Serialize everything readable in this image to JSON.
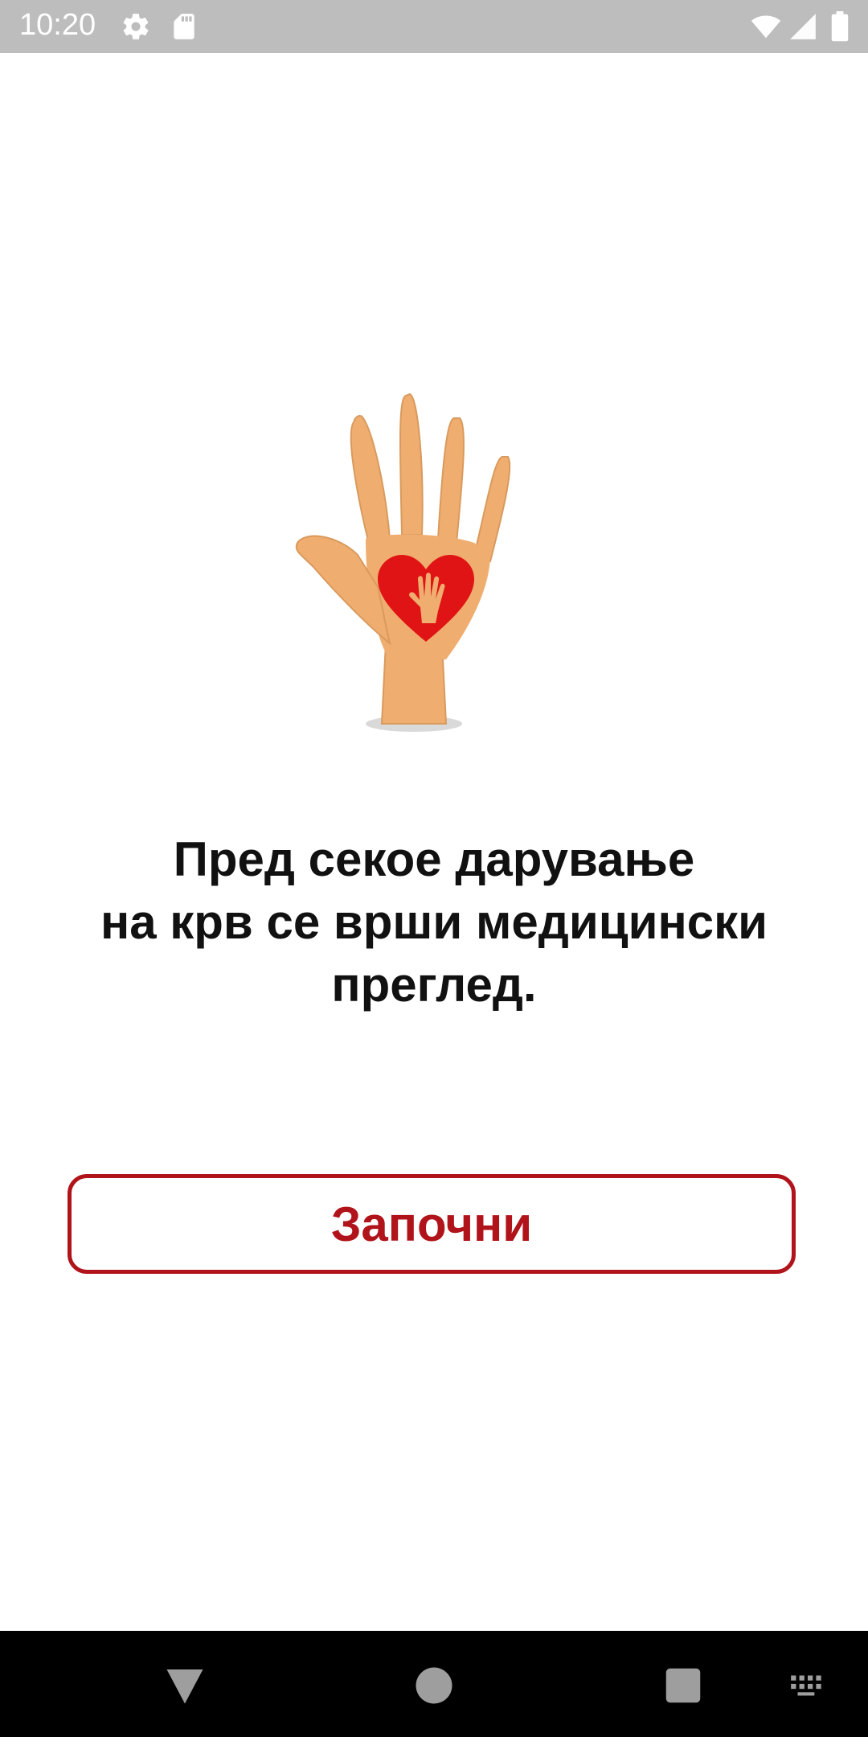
{
  "status_bar": {
    "time": "10:20",
    "icons": [
      "gear-icon",
      "sd-card-icon",
      "wifi-icon",
      "signal-icon",
      "battery-icon"
    ]
  },
  "illustration": {
    "icon": "hand-with-heart-icon"
  },
  "message": {
    "text": "Пред секое дарување\nна крв се врши медицински\nпреглед."
  },
  "start_button": {
    "label": "Започни"
  },
  "nav_bar": {
    "icons": [
      "back-icon",
      "home-icon",
      "recents-icon",
      "keyboard-icon"
    ]
  },
  "colors": {
    "accent": "#b0141a",
    "status_bar": "#bdbdbd",
    "nav_bar": "#000000",
    "heart": "#e01414",
    "skin": "#f0ad70"
  }
}
